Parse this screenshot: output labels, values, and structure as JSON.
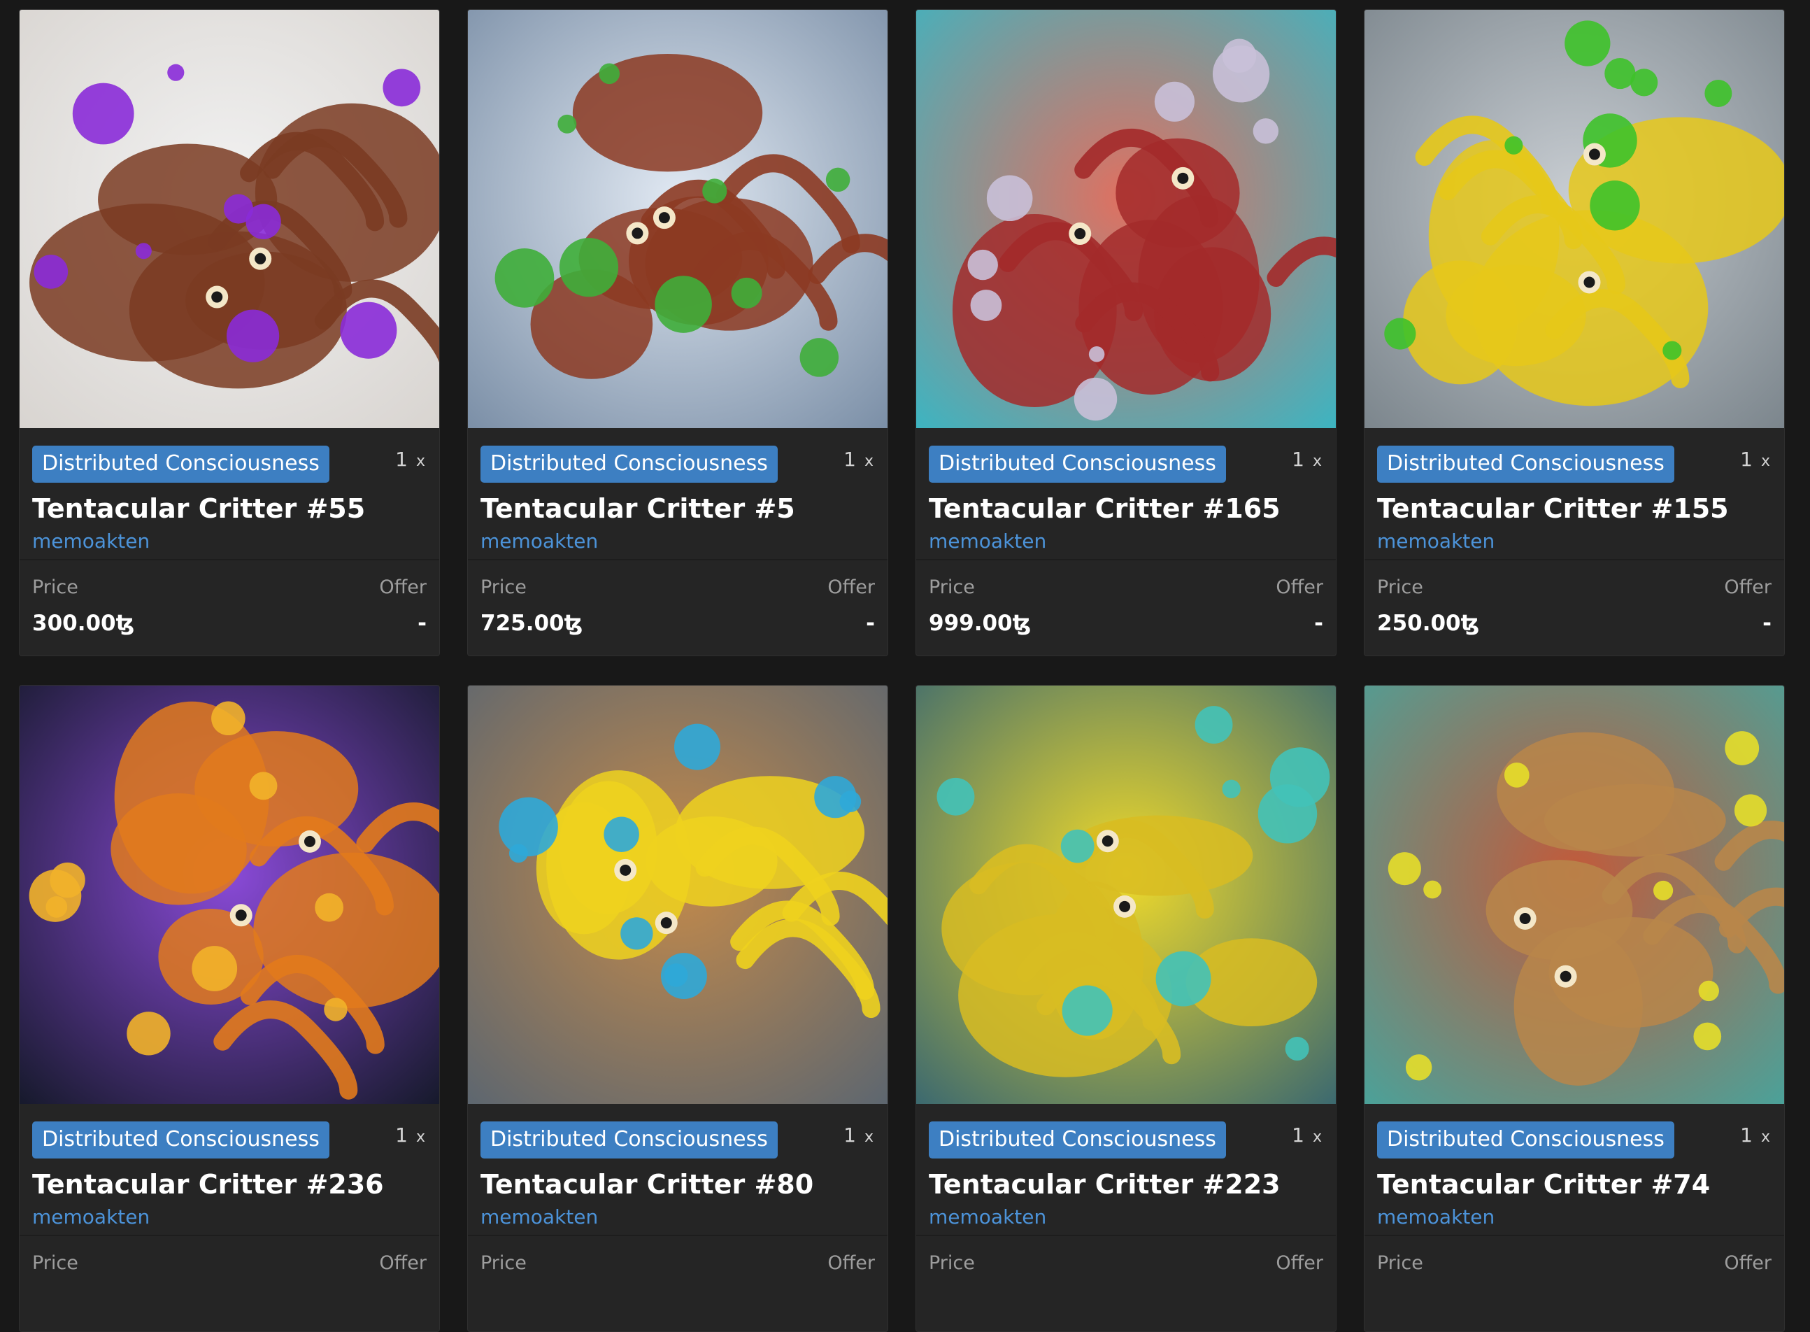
{
  "cards": [
    {
      "badge": "Distributed Consciousness",
      "qty": "1",
      "qty_x": "x",
      "title": "Tentacular Critter #55",
      "creator": "memoakten",
      "price_label": "Price",
      "offer_label": "Offer",
      "price": "300.00ꜩ",
      "offer": "-",
      "palette": {
        "bg": "#d8d4d0",
        "body": "#7a3b22",
        "accent": "#8a2bd8",
        "hi": "#f2f2f2"
      }
    },
    {
      "badge": "Distributed Consciousness",
      "qty": "1",
      "qty_x": "x",
      "title": "Tentacular Critter #5",
      "creator": "memoakten",
      "price_label": "Price",
      "offer_label": "Offer",
      "price": "725.00ꜩ",
      "offer": "-",
      "palette": {
        "bg": "#7a8ea6",
        "body": "#8c3a22",
        "accent": "#3fae3a",
        "hi": "#e0e8f2"
      }
    },
    {
      "badge": "Distributed Consciousness",
      "qty": "1",
      "qty_x": "x",
      "title": "Tentacular Critter #165",
      "creator": "memoakten",
      "price_label": "Price",
      "offer_label": "Offer",
      "price": "999.00ꜩ",
      "offer": "-",
      "palette": {
        "bg": "#3bb5c2",
        "body": "#a32a2a",
        "accent": "#c9c0d8",
        "hi": "#e07060"
      }
    },
    {
      "badge": "Distributed Consciousness",
      "qty": "1",
      "qty_x": "x",
      "title": "Tentacular Critter #155",
      "creator": "memoakten",
      "price_label": "Price",
      "offer_label": "Offer",
      "price": "250.00ꜩ",
      "offer": "-",
      "palette": {
        "bg": "#7b858c",
        "body": "#e6c81a",
        "accent": "#3ec22a",
        "hi": "#c8cdd2"
      }
    },
    {
      "badge": "Distributed Consciousness",
      "qty": "1",
      "qty_x": "x",
      "title": "Tentacular Critter #236",
      "creator": "memoakten",
      "price_label": "Price",
      "offer_label": "Offer",
      "price": "",
      "offer": "",
      "palette": {
        "bg": "#15192a",
        "body": "#e27a1c",
        "accent": "#f2b22a",
        "hi": "#8a4ad8"
      }
    },
    {
      "badge": "Distributed Consciousness",
      "qty": "1",
      "qty_x": "x",
      "title": "Tentacular Critter #80",
      "creator": "memoakten",
      "price_label": "Price",
      "offer_label": "Offer",
      "price": "",
      "offer": "",
      "palette": {
        "bg": "#5c6670",
        "body": "#eed21e",
        "accent": "#2fa8d8",
        "hi": "#c48a4a"
      }
    },
    {
      "badge": "Distributed Consciousness",
      "qty": "1",
      "qty_x": "x",
      "title": "Tentacular Critter #223",
      "creator": "memoakten",
      "price_label": "Price",
      "offer_label": "Offer",
      "price": "",
      "offer": "",
      "palette": {
        "bg": "#3a6870",
        "body": "#d8bc22",
        "accent": "#42c2b8",
        "hi": "#f0da2a"
      }
    },
    {
      "badge": "Distributed Consciousness",
      "qty": "1",
      "qty_x": "x",
      "title": "Tentacular Critter #74",
      "creator": "memoakten",
      "price_label": "Price",
      "offer_label": "Offer",
      "price": "",
      "offer": "",
      "palette": {
        "bg": "#4aa29a",
        "body": "#b8864a",
        "accent": "#e6de2a",
        "hi": "#c25a3a"
      }
    }
  ]
}
